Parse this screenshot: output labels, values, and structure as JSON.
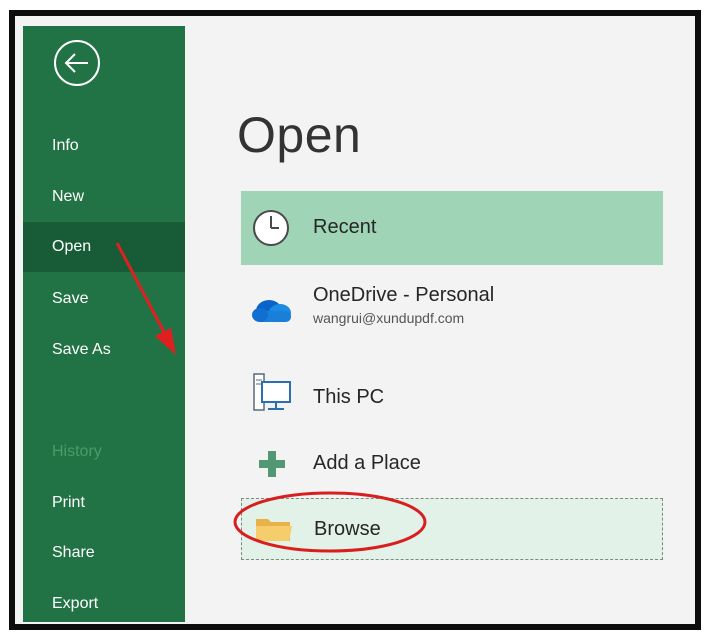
{
  "sidebar": {
    "items": [
      {
        "label": "Info"
      },
      {
        "label": "New"
      },
      {
        "label": "Open"
      },
      {
        "label": "Save"
      },
      {
        "label": "Save As"
      },
      {
        "label": "History"
      },
      {
        "label": "Print"
      },
      {
        "label": "Share"
      },
      {
        "label": "Export"
      }
    ],
    "active_item": "Open",
    "disabled_item": "History",
    "back_icon": "back-arrow-circle-icon"
  },
  "main": {
    "title": "Open",
    "locations": [
      {
        "label": "Recent",
        "icon": "clock-icon",
        "selected": true
      },
      {
        "label": "OneDrive - Personal",
        "sublabel": "wangrui@xundupdf.com",
        "icon": "cloud-icon"
      },
      {
        "label": "This PC",
        "icon": "computer-icon"
      },
      {
        "label": "Add a Place",
        "icon": "plus-icon"
      },
      {
        "label": "Browse",
        "icon": "folder-icon",
        "highlighted": true
      }
    ]
  },
  "colors": {
    "sidebar": "#217346",
    "sidebar_active": "#185c37",
    "recent_highlight": "#9fd5b6",
    "browse_highlight": "#e2f2e8",
    "annotation_red": "#e02020"
  }
}
